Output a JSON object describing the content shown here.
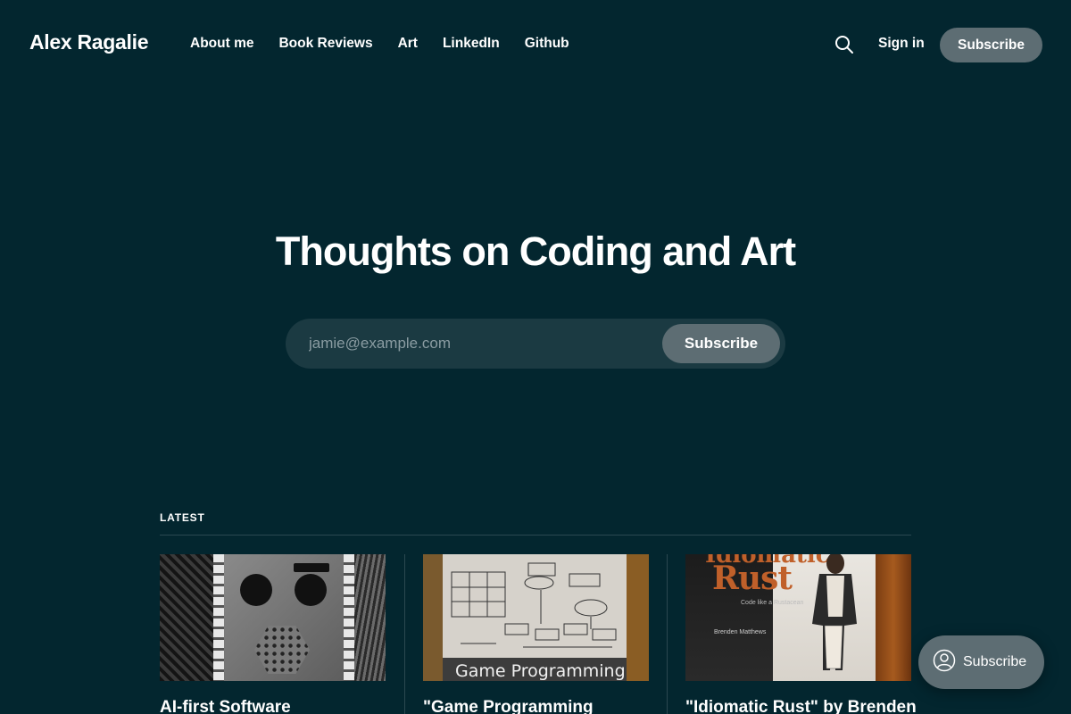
{
  "header": {
    "brand": "Alex Ragalie",
    "nav": [
      "About me",
      "Book Reviews",
      "Art",
      "LinkedIn",
      "Github"
    ],
    "search_icon": "search-icon",
    "signin": "Sign in",
    "subscribe": "Subscribe"
  },
  "hero": {
    "title": "Thoughts on Coding and Art",
    "email_placeholder": "jamie@example.com",
    "subscribe": "Subscribe"
  },
  "latest": {
    "label": "LATEST",
    "posts": [
      {
        "title": "AI-first Software"
      },
      {
        "title": "\"Game Programming"
      },
      {
        "title": "\"Idiomatic Rust\" by Brenden"
      }
    ],
    "thumb_text": {
      "game": "Game Programming",
      "rust_title": "Rust",
      "rust_top": "Idiomatic",
      "rust_sub": "Code like a Rustacean",
      "rust_author": "Brenden Matthews"
    }
  },
  "portal": {
    "label": "Subscribe",
    "icon": "user-icon"
  },
  "colors": {
    "background": "#03262f",
    "button": "#5d6d73",
    "input": "#1b3a42"
  }
}
